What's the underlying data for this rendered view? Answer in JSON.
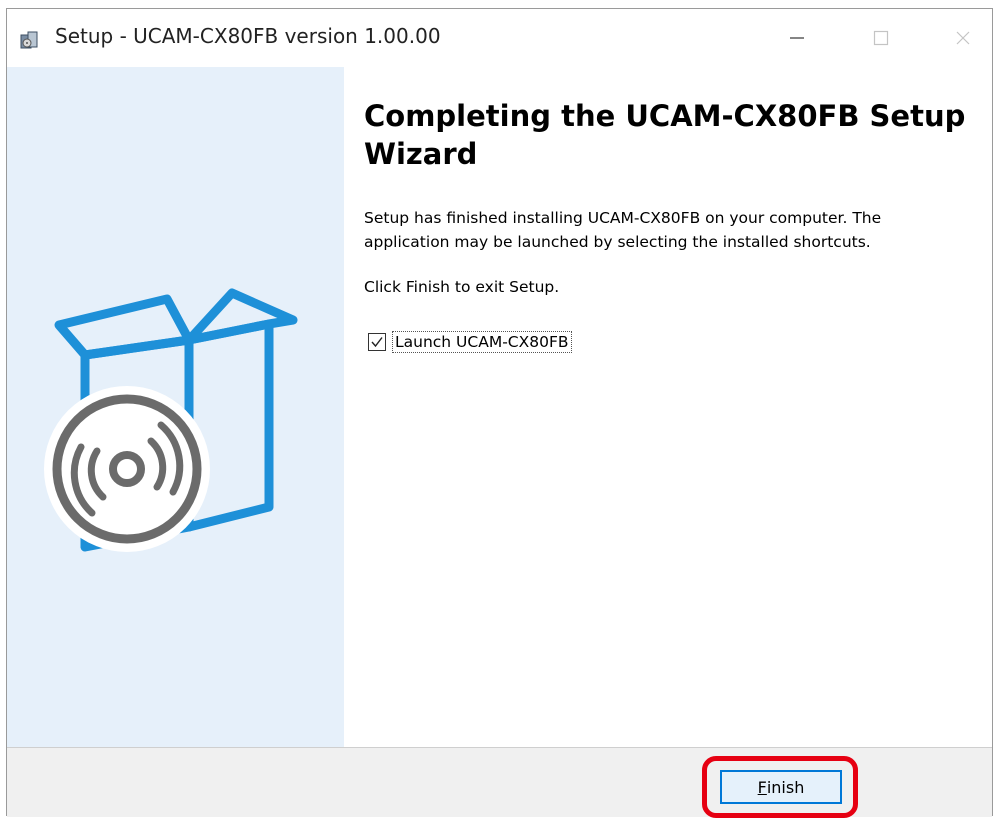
{
  "window": {
    "title": "Setup - UCAM-CX80FB version 1.00.00",
    "icons": {
      "app": "installer-icon",
      "minimize": "minimize-icon",
      "maximize": "maximize-icon",
      "close": "close-icon"
    }
  },
  "wizard": {
    "heading": "Completing the UCAM-CX80FB Setup Wizard",
    "body_text_1": "Setup has finished installing UCAM-CX80FB on your computer. The application may be launched by selecting the installed shortcuts.",
    "body_text_2": "Click Finish to exit Setup.",
    "launch_checkbox": {
      "label": "Launch UCAM-CX80FB",
      "checked": true
    },
    "illustration": "box-with-disc-illustration"
  },
  "footer": {
    "finish_mnemonic": "F",
    "finish_rest": "inish",
    "highlight_color": "#e60012"
  },
  "colors": {
    "sidebar_bg": "#e6f0fa",
    "box_blue": "#1e90d8",
    "disc_gray": "#6b6b6b",
    "button_border": "#0078d7"
  }
}
